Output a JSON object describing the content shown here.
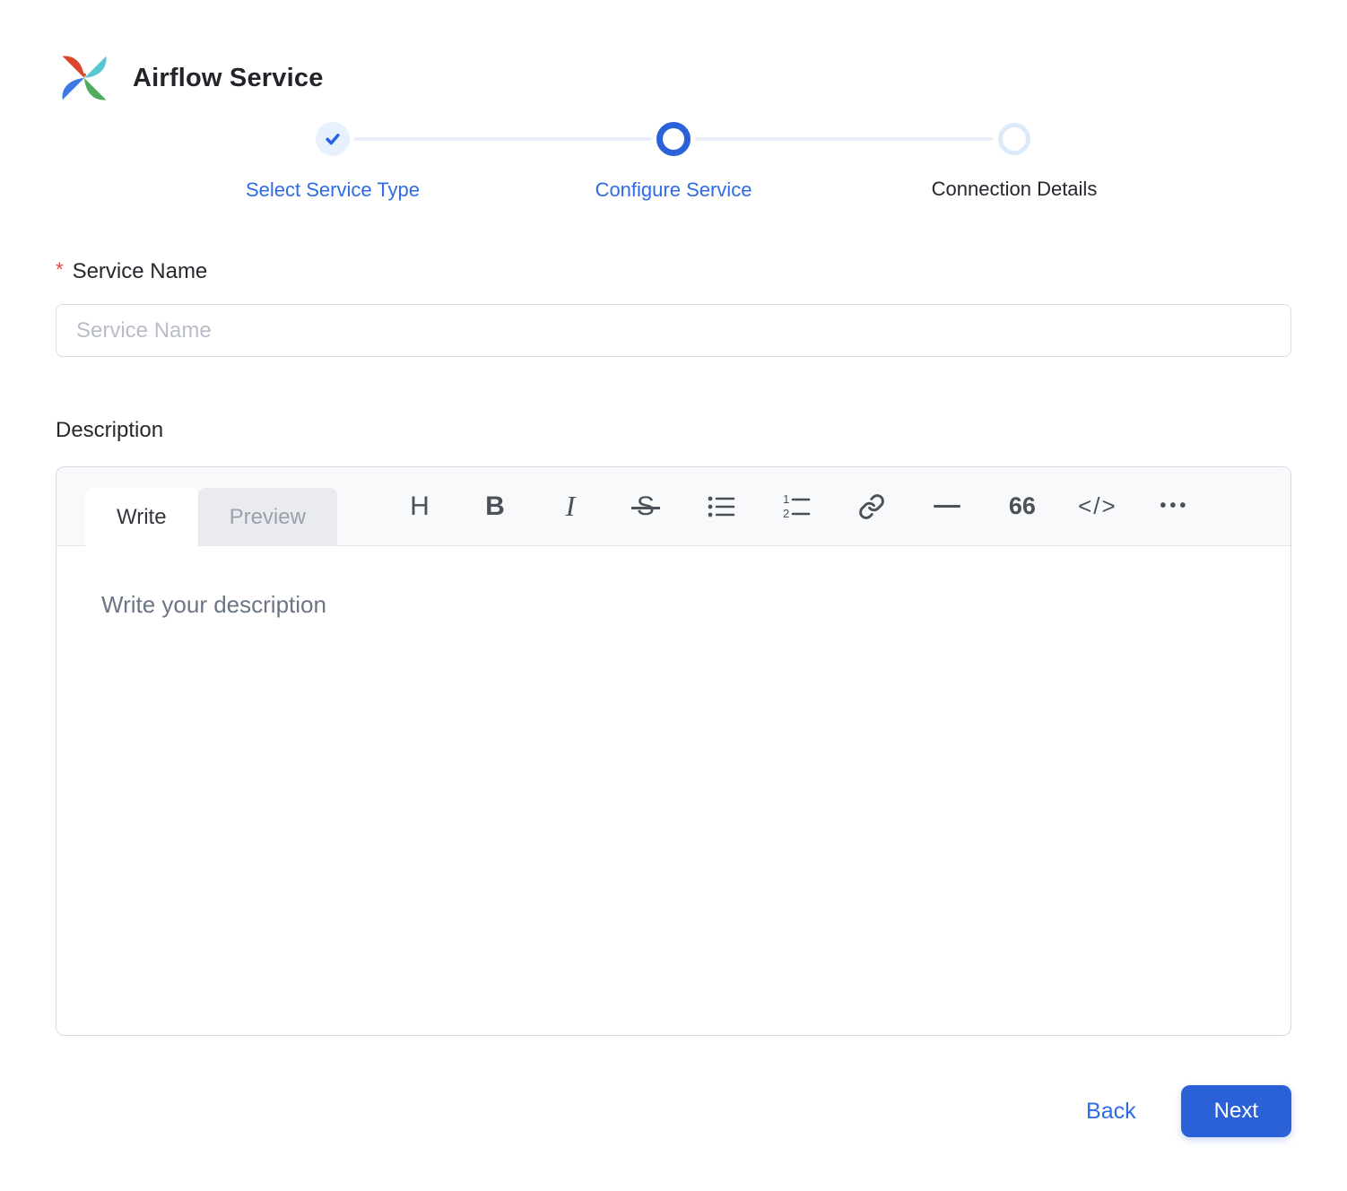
{
  "header": {
    "title": "Airflow Service",
    "logo_icon": "airflow-pinwheel-icon"
  },
  "stepper": {
    "steps": [
      {
        "label": "Select Service Type",
        "state": "completed"
      },
      {
        "label": "Configure Service",
        "state": "active"
      },
      {
        "label": "Connection Details",
        "state": "pending"
      }
    ]
  },
  "form": {
    "service_name": {
      "label": "Service Name",
      "required_marker": "*",
      "placeholder": "Service Name",
      "value": ""
    },
    "description": {
      "label": "Description",
      "editor": {
        "tabs": [
          {
            "label": "Write",
            "active": true
          },
          {
            "label": "Preview",
            "active": false
          }
        ],
        "toolbar": [
          {
            "name": "heading",
            "glyph": "H"
          },
          {
            "name": "bold",
            "glyph": "B"
          },
          {
            "name": "italic",
            "glyph": "I"
          },
          {
            "name": "strikethrough",
            "glyph": "S"
          },
          {
            "name": "unordered-list",
            "glyph": ""
          },
          {
            "name": "ordered-list",
            "glyph": ""
          },
          {
            "name": "link",
            "glyph": ""
          },
          {
            "name": "horizontal-rule",
            "glyph": ""
          },
          {
            "name": "quote",
            "glyph": "66"
          },
          {
            "name": "code",
            "glyph": "</>"
          },
          {
            "name": "more",
            "glyph": "•••"
          }
        ],
        "placeholder": "Write your description",
        "value": ""
      }
    }
  },
  "footer": {
    "back_label": "Back",
    "next_label": "Next"
  },
  "colors": {
    "primary_blue": "#2e6be6",
    "button_blue": "#2b61d6",
    "step_active_ring": "#2b62d9",
    "step_completed_bg": "#e7f1fd",
    "step_pending_ring": "#ddeafa",
    "required_red": "#f0443b",
    "editor_header_bg": "#f8f9fb",
    "placeholder_gray": "#b9bdc7"
  }
}
